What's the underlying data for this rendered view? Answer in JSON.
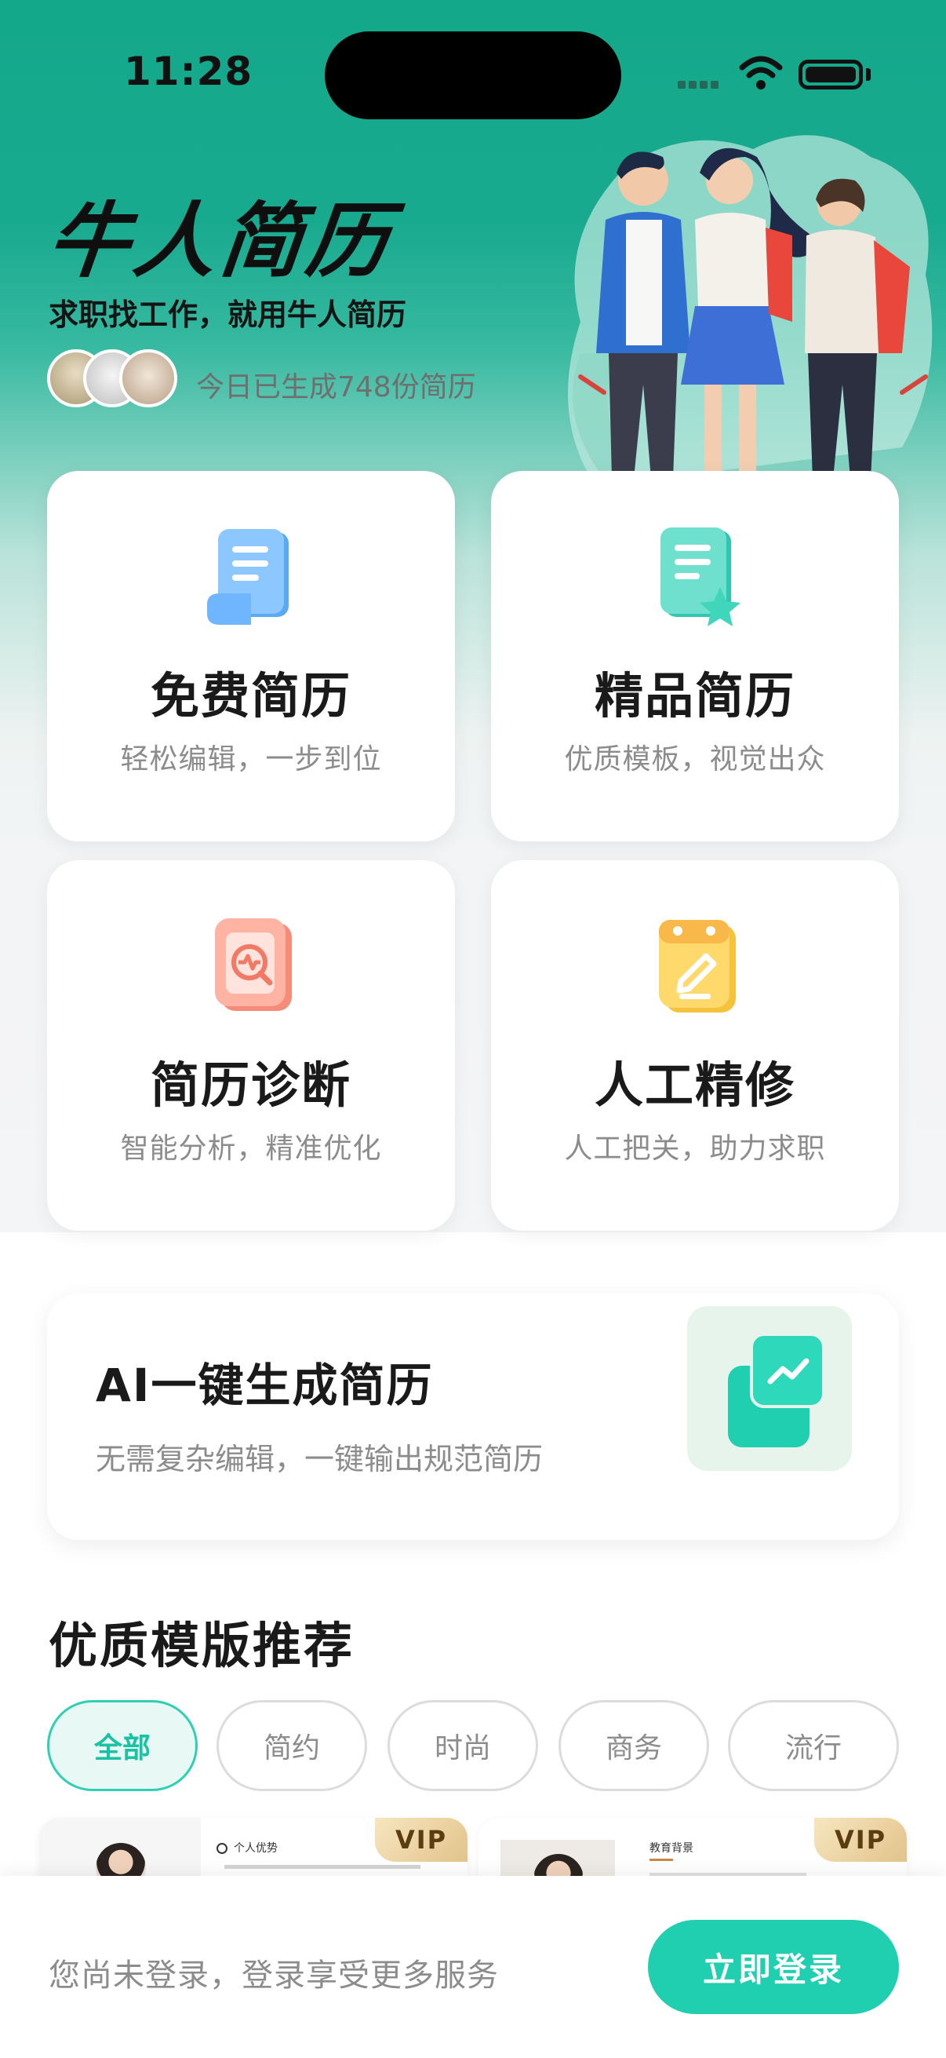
{
  "status_bar": {
    "time": "11:28"
  },
  "hero": {
    "title": "牛人简历",
    "slogan": "求职找工作，就用牛人简历",
    "counter": "今日已生成748份简历"
  },
  "features": [
    {
      "title": "免费简历",
      "subtitle": "轻松编辑，一步到位",
      "icon": "scroll-document-icon"
    },
    {
      "title": "精品简历",
      "subtitle": "优质模板，视觉出众",
      "icon": "star-document-icon"
    },
    {
      "title": "简历诊断",
      "subtitle": "智能分析，精准优化",
      "icon": "diagnosis-icon"
    },
    {
      "title": "人工精修",
      "subtitle": "人工把关，助力求职",
      "icon": "edit-calendar-icon"
    }
  ],
  "ai_banner": {
    "title": "AI一键生成简历",
    "subtitle": "无需复杂编辑，一键输出规范简历",
    "icon": "trend-chart-icon"
  },
  "templates": {
    "section_title": "优质模版推荐",
    "filters": [
      "全部",
      "简约",
      "时尚",
      "商务",
      "流行"
    ],
    "selected_filter": "全部",
    "items": [
      {
        "badge": "VIP",
        "section_heading": "个人优势"
      },
      {
        "badge": "VIP",
        "section_heading": "教育背景"
      }
    ]
  },
  "login_bar": {
    "prompt": "您尚未登录，登录享受更多服务",
    "button": "立即登录"
  },
  "colors": {
    "accent": "#1fcfb0",
    "hero_green": "#14a88a"
  }
}
